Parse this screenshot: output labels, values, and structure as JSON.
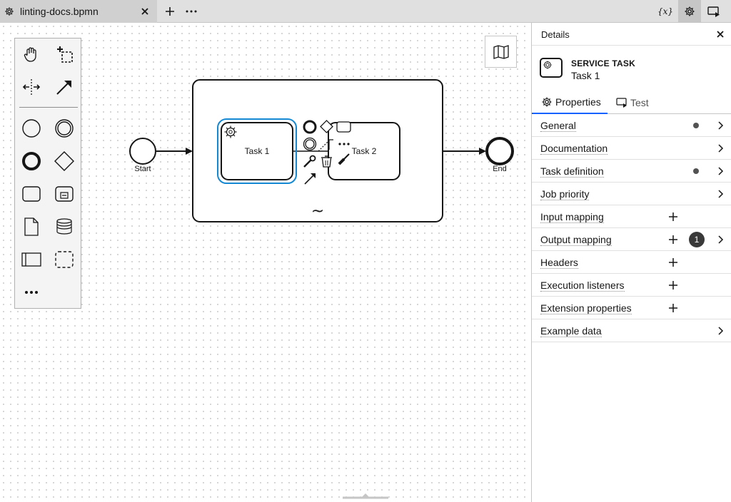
{
  "tabs": [
    {
      "title": "linting-docs.bpmn",
      "icon": "gear-icon",
      "active": true
    }
  ],
  "toolbar": {
    "variables_icon_label": "{x}"
  },
  "diagram": {
    "start_label": "Start",
    "end_label": "End",
    "task1_label": "Task 1",
    "task2_label": "Task 2",
    "subprocess_marker": "~"
  },
  "details": {
    "header_title": "Details",
    "element_type": "SERVICE TASK",
    "element_name": "Task 1",
    "tabs": [
      {
        "label": "Properties",
        "icon": "gear-icon",
        "active": true
      },
      {
        "label": "Test",
        "icon": "test-icon",
        "active": false
      }
    ],
    "groups": [
      {
        "label": "General",
        "dot": true,
        "plus": false,
        "badge": "",
        "chevron": true
      },
      {
        "label": "Documentation",
        "dot": false,
        "plus": false,
        "badge": "",
        "chevron": true
      },
      {
        "label": "Task definition",
        "dot": true,
        "plus": false,
        "badge": "",
        "chevron": true
      },
      {
        "label": "Job priority",
        "dot": false,
        "plus": false,
        "badge": "",
        "chevron": true
      },
      {
        "label": "Input mapping",
        "dot": false,
        "plus": true,
        "badge": "",
        "chevron": false
      },
      {
        "label": "Output mapping",
        "dot": false,
        "plus": true,
        "badge": "1",
        "chevron": true
      },
      {
        "label": "Headers",
        "dot": false,
        "plus": true,
        "badge": "",
        "chevron": false
      },
      {
        "label": "Execution listeners",
        "dot": false,
        "plus": true,
        "badge": "",
        "chevron": false
      },
      {
        "label": "Extension properties",
        "dot": false,
        "plus": true,
        "badge": "",
        "chevron": false
      },
      {
        "label": "Example data",
        "dot": false,
        "plus": false,
        "badge": "",
        "chevron": true
      }
    ]
  },
  "colors": {
    "selection": "#1589d4",
    "accent": "#0f62fe",
    "badge": "#393939"
  }
}
